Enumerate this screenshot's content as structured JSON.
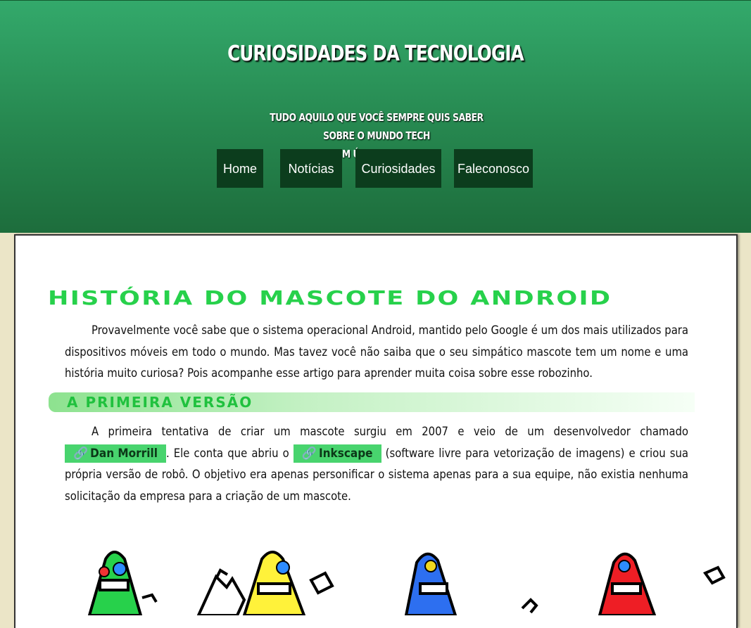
{
  "header": {
    "title": "CURIOSIDADES DA TECNOLOGIA",
    "subtitle_line1": "TUDO AQUILO QUE VOCÊ SEMPRE QUIS SABER SOBRE O MUNDO TECH",
    "subtitle_line2": "EM ÚNICO LUGAR"
  },
  "nav": {
    "items": [
      {
        "label": "Home"
      },
      {
        "label": "Notícias"
      },
      {
        "label": "Curiosidades"
      },
      {
        "label": "Faleconosco"
      }
    ]
  },
  "article": {
    "heading": "História do mascote do Android",
    "intro": "Provavelmente você sabe que o sistema operacional Android, mantido pelo Google é um dos mais utilizados para dispositivos móveis em todo o mundo. Mas tavez você não saiba que o seu simpático mascote tem um nome e uma história muito curiosa? Pois acompanhe esse artigo para aprender muita coisa sobre esse robozinho.",
    "section1": {
      "heading": "A primeira versão",
      "text_part1": "A primeira tentativa de criar um mascote surgiu em 2007 e veio de um desenvolvedor chamado",
      "link1_label": "Dan Morrill",
      "text_part2": ". Ele conta que abriu o",
      "link2_label": "Inkscape",
      "text_part3": "(software livre para vetorização de imagens) e criou sua própria versão de robô. O objetivo era apenas personificar o sistema apenas para a sua equipe, não existia nenhuma solicitação da empresa para a criação de um mascote."
    }
  },
  "icons": {
    "link": "link-icon"
  },
  "colors": {
    "header_green": "#2b9a5c",
    "nav_bg": "#0c3d1d",
    "heading_green": "#27d14b",
    "link_bg": "#48d46e",
    "page_bg": "#ebe5c7"
  }
}
